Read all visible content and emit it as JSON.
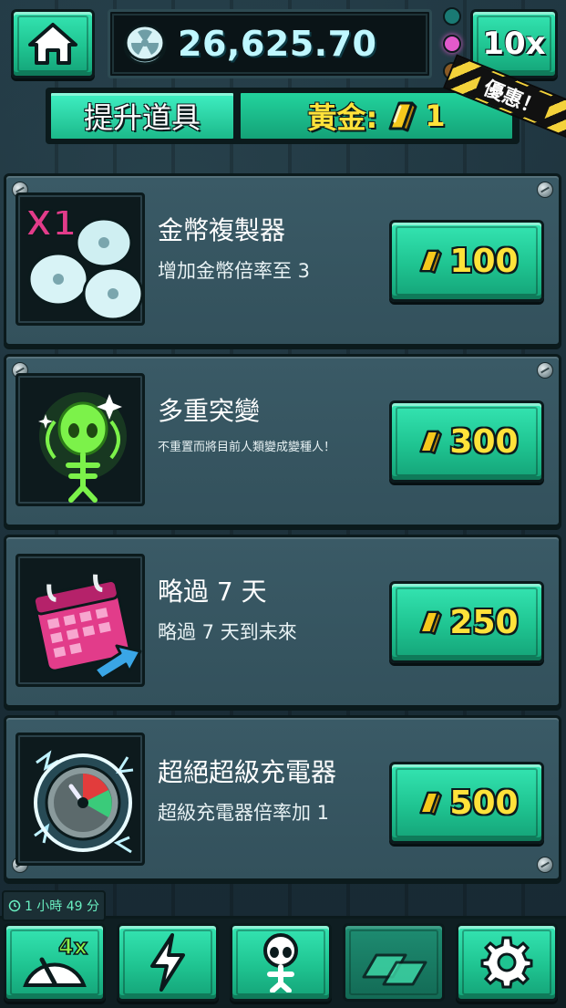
{
  "header": {
    "currency_amount": "26,625.70",
    "multiplier_label": "10x"
  },
  "tabs": {
    "upgrades_label": "提升道具",
    "gold_label": "黃金:",
    "gold_count": "1",
    "sale_label": "優惠！"
  },
  "items": [
    {
      "title": "金幣複製器",
      "desc": "增加金幣倍率至 3",
      "price": "100",
      "icon": "coin-copier-icon",
      "badge": "X1"
    },
    {
      "title": "多重突變",
      "desc": "不重置而將目前人類變成變種人！",
      "price": "300",
      "icon": "mutant-icon"
    },
    {
      "title": "略過 7 天",
      "desc": "略過 7 天到未來",
      "price": "250",
      "icon": "calendar-skip-icon"
    },
    {
      "title": "超絕超級充電器",
      "desc": "超級充電器倍率加 1",
      "price": "500",
      "icon": "super-charger-icon"
    }
  ],
  "footer": {
    "timer_text": "1 小時 49 分",
    "speed_badge": "4x"
  },
  "colors": {
    "accent_teal": "#1fc491",
    "gold": "#ffe23a",
    "panel": "#3a5a66"
  }
}
